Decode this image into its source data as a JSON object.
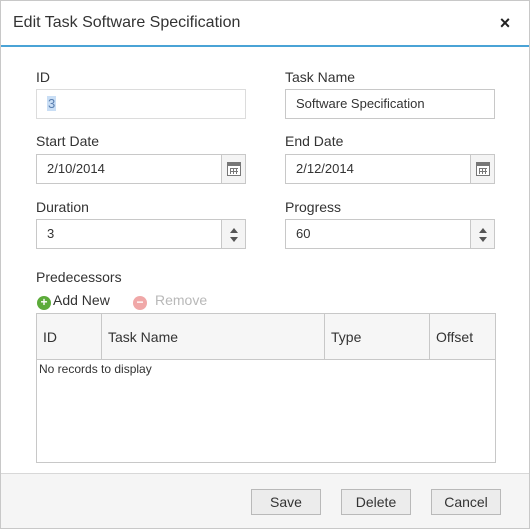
{
  "dialog": {
    "title": "Edit Task Software Specification",
    "close_glyph": "×"
  },
  "fields": {
    "id": {
      "label": "ID",
      "value": "3"
    },
    "task_name": {
      "label": "Task Name",
      "value": "Software Specification"
    },
    "start_date": {
      "label": "Start Date",
      "value": "2/10/2014",
      "icon": "calendar-icon"
    },
    "end_date": {
      "label": "End Date",
      "value": "2/12/2014",
      "icon": "calendar-icon"
    },
    "duration": {
      "label": "Duration",
      "value": "3"
    },
    "progress": {
      "label": "Progress",
      "value": "60"
    }
  },
  "predecessors": {
    "label": "Predecessors",
    "add_label": "Add New",
    "remove_label": "Remove",
    "add_glyph": "+",
    "remove_glyph": "−",
    "columns": [
      "ID",
      "Task Name",
      "Type",
      "Offset"
    ],
    "empty_text": "No records to display"
  },
  "footer": {
    "save_label": "Save",
    "delete_label": "Delete",
    "cancel_label": "Cancel"
  },
  "colors": {
    "accent": "#4aa3d6",
    "add": "#5cab3a",
    "remove_disabled": "#f0a8a8"
  }
}
